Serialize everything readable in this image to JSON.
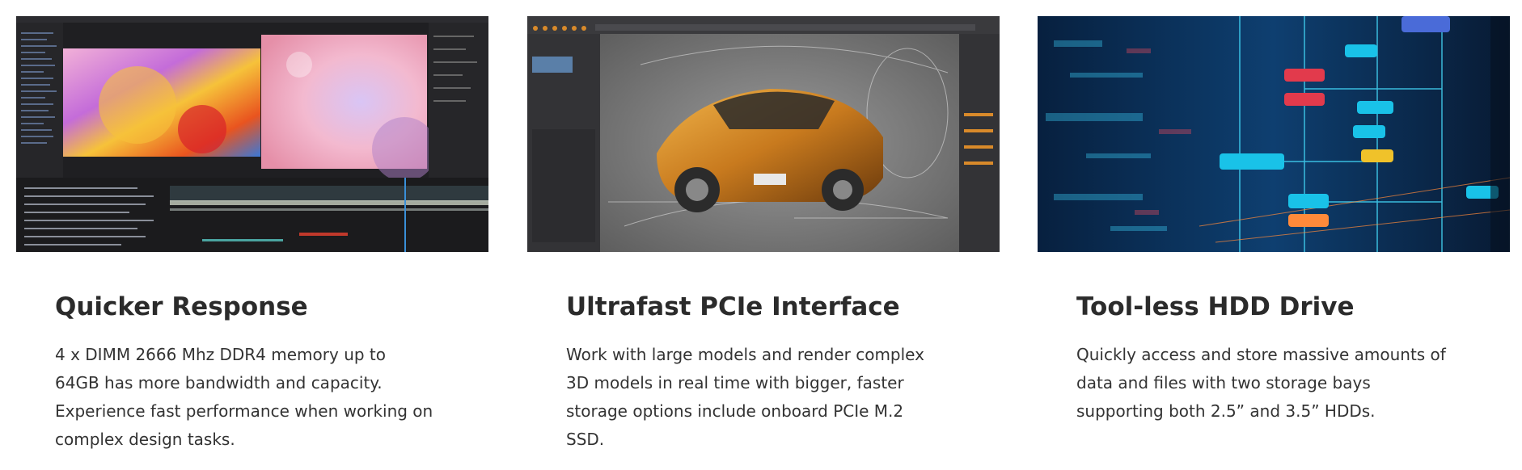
{
  "features": [
    {
      "title": "Quicker Response",
      "description": "4 x DIMM 2666 Mhz DDR4 memory up to 64GB has more bandwidth and capacity. Experience fast performance when working on complex design tasks.",
      "image": "video-editing-screenshot"
    },
    {
      "title": "Ultrafast PCIe Interface",
      "description": "Work with large models and render complex 3D models in real time with bigger, faster storage options include onboard PCIe M.2 SSD.",
      "image": "car-3d-modeling-screenshot"
    },
    {
      "title": "Tool-less HDD Drive",
      "description": "Quickly access and store massive amounts of data and files with two storage bays supporting both 2.5” and 3.5” HDDs.",
      "image": "data-network-visualization"
    }
  ]
}
